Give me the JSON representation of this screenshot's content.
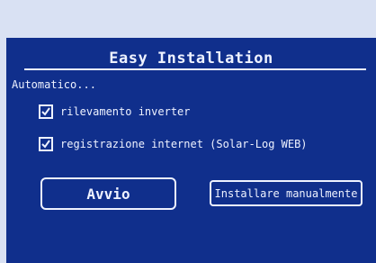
{
  "dialog": {
    "title": "Easy Installation",
    "subtitle": "Automatico...",
    "options": [
      {
        "label": "rilevamento inverter",
        "checked": true
      },
      {
        "label": "registrazione internet (Solar-Log WEB)",
        "checked": true
      }
    ],
    "start_button": "Avvio",
    "manual_button": "Installare manualmente"
  },
  "colors": {
    "screen_background": "#102f8c",
    "foreground": "#eef2ff",
    "bezel": "#d9e1f3"
  }
}
